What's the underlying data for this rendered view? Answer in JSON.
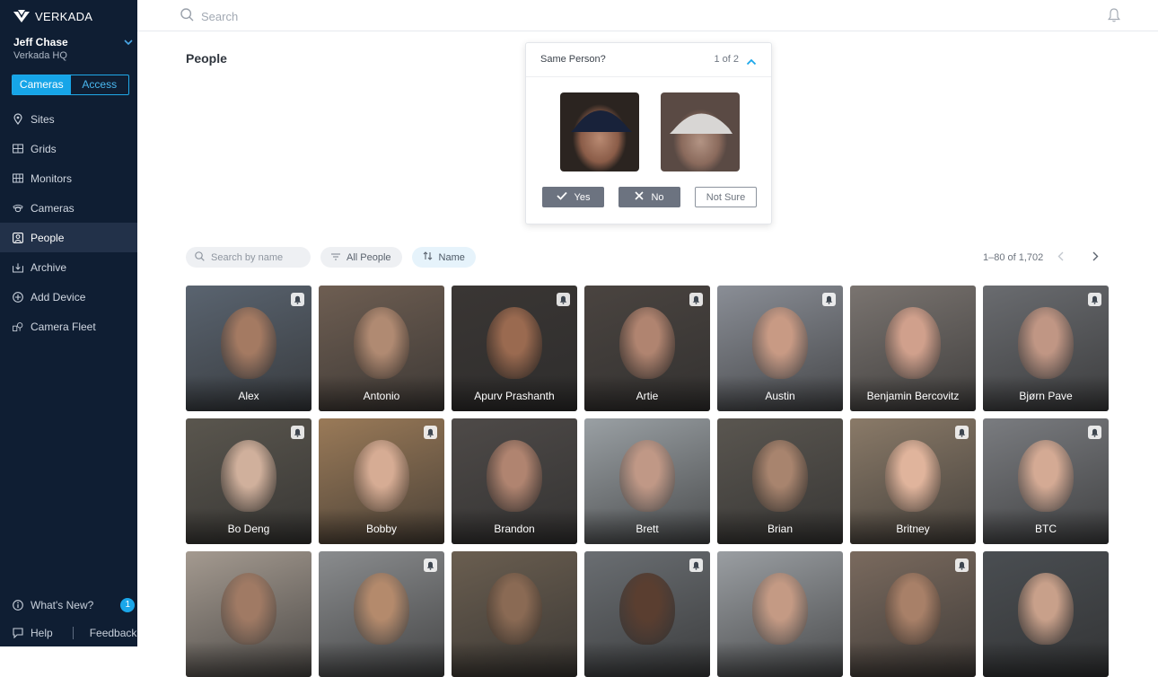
{
  "brand": {
    "name": "VERKADA"
  },
  "user": {
    "name": "Jeff Chase",
    "org": "Verkada HQ"
  },
  "switcher": {
    "cameras": "Cameras",
    "access": "Access"
  },
  "nav": [
    {
      "label": "Sites",
      "icon": "pin-icon"
    },
    {
      "label": "Grids",
      "icon": "grid-icon"
    },
    {
      "label": "Monitors",
      "icon": "monitor-icon"
    },
    {
      "label": "Cameras",
      "icon": "camera-icon"
    },
    {
      "label": "People",
      "icon": "person-icon",
      "active": true
    },
    {
      "label": "Archive",
      "icon": "archive-icon"
    },
    {
      "label": "Add Device",
      "icon": "plus-circle-icon"
    },
    {
      "label": "Camera Fleet",
      "icon": "camera-fleet-icon"
    }
  ],
  "bottom": {
    "whats_new": "What's New?",
    "whats_new_count": "1",
    "help": "Help",
    "feedback": "Feedback"
  },
  "search": {
    "placeholder": "Search"
  },
  "page": {
    "title": "People"
  },
  "popover": {
    "title": "Same Person?",
    "count": "1 of 2",
    "yes": "Yes",
    "no": "No",
    "not_sure": "Not Sure"
  },
  "filters": {
    "search_placeholder": "Search by name",
    "all_people": "All People",
    "sort": "Name"
  },
  "pagination": {
    "range": "1–80 of 1,702"
  },
  "colors": {
    "sidebar": "#0f1e33",
    "accent": "#16a5e8",
    "active_nav": "#223149"
  },
  "people": [
    {
      "name": "Alex",
      "alert": true
    },
    {
      "name": "Antonio",
      "alert": false
    },
    {
      "name": "Apurv Prashanth",
      "alert": true
    },
    {
      "name": "Artie",
      "alert": true
    },
    {
      "name": "Austin",
      "alert": true
    },
    {
      "name": "Benjamin Bercovitz",
      "alert": false
    },
    {
      "name": "Bjørn Pave",
      "alert": true
    },
    {
      "name": "Bo Deng",
      "alert": true
    },
    {
      "name": "Bobby",
      "alert": true
    },
    {
      "name": "Brandon",
      "alert": false
    },
    {
      "name": "Brett",
      "alert": false
    },
    {
      "name": "Brian",
      "alert": false
    },
    {
      "name": "Britney",
      "alert": true
    },
    {
      "name": "BTC",
      "alert": true
    },
    {
      "name": "",
      "alert": false
    },
    {
      "name": "",
      "alert": true
    },
    {
      "name": "",
      "alert": false
    },
    {
      "name": "",
      "alert": true
    },
    {
      "name": "",
      "alert": false
    },
    {
      "name": "",
      "alert": true
    },
    {
      "name": "",
      "alert": false
    }
  ]
}
